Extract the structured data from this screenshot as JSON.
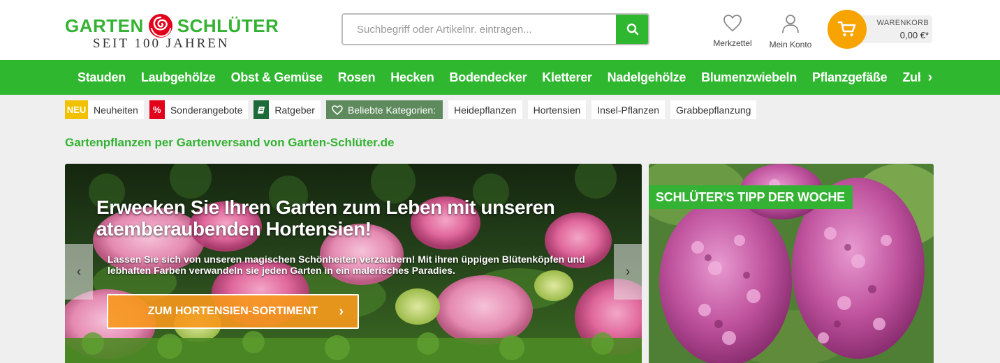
{
  "brand": {
    "name_left": "GARTEN",
    "name_right": "SCHLÜTER",
    "tagline": "SEIT 100 JAHREN",
    "green": "#34b233",
    "accent_orange": "#f7a300"
  },
  "search": {
    "placeholder": "Suchbegriff oder Artikelnr. eintragen...",
    "value": "",
    "button_icon": "search-icon"
  },
  "header_links": {
    "wishlist": {
      "label": "Merkzettel",
      "icon": "heart-icon"
    },
    "account": {
      "label": "Mein Konto",
      "icon": "user-icon"
    }
  },
  "cart": {
    "title": "WARENKORB",
    "total": "0,00 €*",
    "icon": "cart-icon"
  },
  "nav": {
    "items": [
      "Stauden",
      "Laubgehölze",
      "Obst & Gemüse",
      "Rosen",
      "Hecken",
      "Bodendecker",
      "Kletterer",
      "Nadelgehölze",
      "Blumenzwiebeln",
      "Pflanzgefäße",
      "Zubehör"
    ],
    "next_arrow": "›"
  },
  "chips": {
    "new": {
      "tag": "NEU",
      "label": "Neuheiten",
      "tag_color": "#f2c200"
    },
    "sale": {
      "tag": "%",
      "label": "Sonderangebote",
      "tag_color": "#e2001a"
    },
    "guide": {
      "label": "Ratgeber",
      "tag_color": "#1e6b3a"
    },
    "favorites": {
      "label": "Beliebte Kategorien:",
      "bg_color": "#5e8a5e"
    },
    "categories": [
      "Heidepflanzen",
      "Hortensien",
      "Insel-Pflanzen",
      "Grabbepflanzung"
    ]
  },
  "intro_heading": "Gartenpflanzen per Gartenversand von Garten-Schlüter.de",
  "hero": {
    "title": "Erwecken Sie Ihren Garten zum Leben mit unseren atemberaubenden Hortensien!",
    "text": "Lassen Sie sich von unseren magischen Schönheiten verzaubern! Mit ihren üppigen Blütenköpfen und lebhaften Farben verwandeln sie jeden Garten in ein malerisches Paradies.",
    "button_label": "ZUM HORTENSIEN-SORTIMENT",
    "button_chevron": "›",
    "prev_arrow": "‹",
    "next_arrow": "›"
  },
  "tip": {
    "badge": "SCHLÜTER'S TIPP DER WOCHE"
  }
}
